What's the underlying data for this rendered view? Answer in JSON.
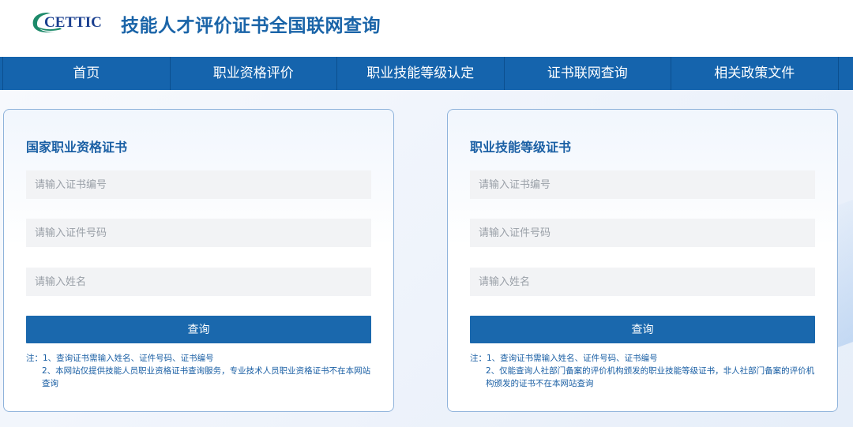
{
  "header": {
    "logo_text": "CETTIC",
    "title": "技能人才评价证书全国联网查询"
  },
  "nav": {
    "items": [
      {
        "label": "首页"
      },
      {
        "label": "职业资格评价"
      },
      {
        "label": "职业技能等级认定"
      },
      {
        "label": "证书联网查询"
      },
      {
        "label": "相关政策文件"
      }
    ]
  },
  "colors": {
    "brand_blue": "#1564ad",
    "title_blue": "#1a5fa4",
    "field_bg": "#f2f3f5",
    "card_border": "#8fb3db"
  },
  "cards": [
    {
      "title": "国家职业资格证书",
      "fields": [
        {
          "placeholder": "请输入证书编号",
          "value": ""
        },
        {
          "placeholder": "请输入证件号码",
          "value": ""
        },
        {
          "placeholder": "请输入姓名",
          "value": ""
        }
      ],
      "button": "查询",
      "note1": "注：1、查询证书需输入姓名、证件号码、证书编号",
      "note2": "2、本网站仅提供技能人员职业资格证书查询服务，专业技术人员职业资格证书不在本网站查询"
    },
    {
      "title": "职业技能等级证书",
      "fields": [
        {
          "placeholder": "请输入证书编号",
          "value": ""
        },
        {
          "placeholder": "请输入证件号码",
          "value": ""
        },
        {
          "placeholder": "请输入姓名",
          "value": ""
        }
      ],
      "button": "查询",
      "note1": "注：1、查询证书需输入姓名、证件号码、证书编号",
      "note2": "2、仅能查询人社部门备案的评价机构颁发的职业技能等级证书，非人社部门备案的评价机构颁发的证书不在本网站查询"
    }
  ]
}
